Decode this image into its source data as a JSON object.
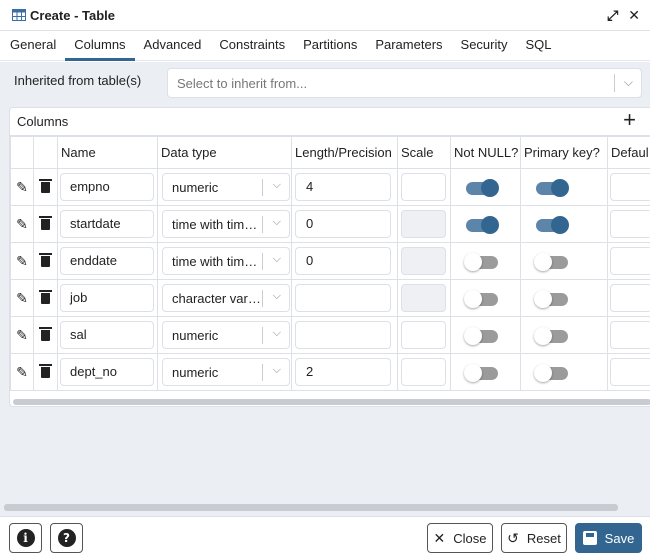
{
  "window": {
    "title": "Create - Table",
    "expand_icon": "expand-icon",
    "close_icon": "close-icon"
  },
  "tabs": [
    "General",
    "Columns",
    "Advanced",
    "Constraints",
    "Partitions",
    "Parameters",
    "Security",
    "SQL"
  ],
  "active_tab": "Columns",
  "inherit": {
    "label": "Inherited from table(s)",
    "placeholder": "Select to inherit from..."
  },
  "columns_panel": {
    "title": "Columns",
    "headers": [
      "Name",
      "Data type",
      "Length/Precision",
      "Scale",
      "Not NULL?",
      "Primary key?",
      "Defaul"
    ],
    "rows": [
      {
        "name": "empno",
        "type": "numeric",
        "length": "4",
        "scale": "",
        "scale_disabled": false,
        "not_null": true,
        "pk": true
      },
      {
        "name": "startdate",
        "type": "time with time ...",
        "length": "0",
        "scale": "",
        "scale_disabled": true,
        "not_null": true,
        "pk": true
      },
      {
        "name": "enddate",
        "type": "time with time ...",
        "length": "0",
        "scale": "",
        "scale_disabled": true,
        "not_null": false,
        "pk": false
      },
      {
        "name": "job",
        "type": "character varyi...",
        "length": "",
        "scale": "",
        "scale_disabled": true,
        "not_null": false,
        "pk": false
      },
      {
        "name": "sal",
        "type": "numeric",
        "length": "",
        "scale": "",
        "scale_disabled": false,
        "not_null": false,
        "pk": false
      },
      {
        "name": "dept_no",
        "type": "numeric",
        "length": "2",
        "scale": "",
        "scale_disabled": false,
        "not_null": false,
        "pk": false
      }
    ]
  },
  "footer": {
    "close": "Close",
    "reset": "Reset",
    "save": "Save"
  },
  "colors": {
    "accent": "#326690",
    "toggle_on_track": "#5d84a9",
    "toggle_off_track": "#9b9b9b",
    "panel_bg": "#ebeef3"
  }
}
